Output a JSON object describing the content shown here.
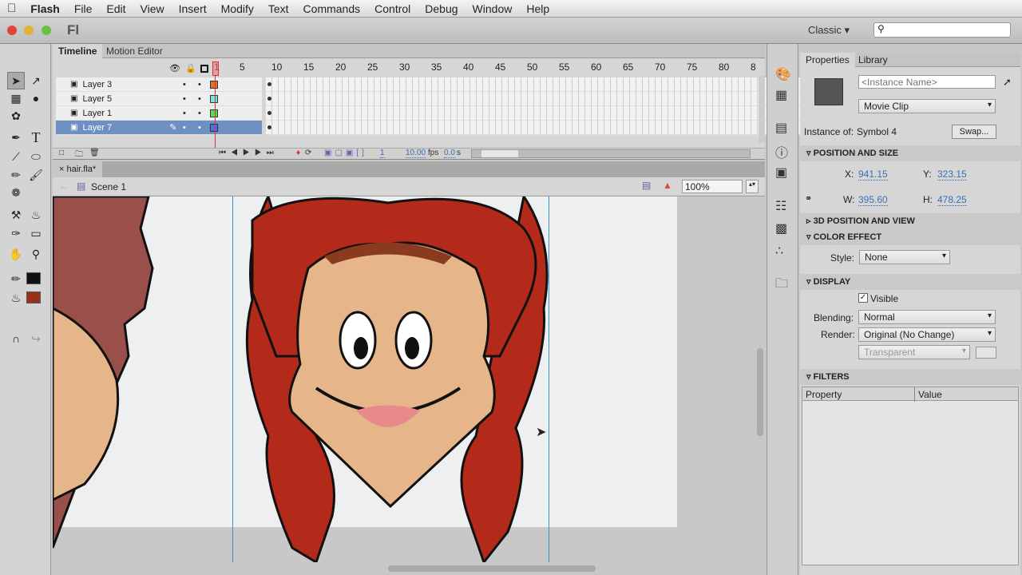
{
  "menu": {
    "apple": "",
    "items": [
      "Flash",
      "File",
      "Edit",
      "View",
      "Insert",
      "Modify",
      "Text",
      "Commands",
      "Control",
      "Debug",
      "Window",
      "Help"
    ]
  },
  "appbar": {
    "logo": "Fl",
    "workspace": "Classic",
    "search_placeholder": ""
  },
  "timeline": {
    "tabs": [
      "Timeline",
      "Motion Editor"
    ],
    "ruler": [
      "1",
      "5",
      "10",
      "15",
      "20",
      "25",
      "30",
      "35",
      "40",
      "45",
      "50",
      "55",
      "60",
      "65",
      "70",
      "75",
      "80",
      "8"
    ],
    "layers": [
      {
        "name": "Layer 3",
        "color": "#e07030"
      },
      {
        "name": "Layer 5",
        "color": "#70e8e0"
      },
      {
        "name": "Layer 1",
        "color": "#50e050"
      },
      {
        "name": "Layer 7",
        "color": "#4a70e0",
        "selected": true
      }
    ],
    "current_frame": "1",
    "fps": "10.00",
    "fps_unit": "fps",
    "time": "0.0",
    "time_unit": "s"
  },
  "document": {
    "tab": "hair.fla*",
    "scene": "Scene 1",
    "zoom": "100%"
  },
  "properties": {
    "tabs": [
      "Properties",
      "Library"
    ],
    "instance_name_placeholder": "<Instance Name>",
    "type": "Movie Clip",
    "instance_of_label": "Instance of:",
    "instance_of": "Symbol 4",
    "swap": "Swap...",
    "position_size": {
      "title": "POSITION AND SIZE",
      "x_label": "X:",
      "x": "941.15",
      "y_label": "Y:",
      "y": "323.15",
      "w_label": "W:",
      "w": "395.60",
      "h_label": "H:",
      "h": "478.25"
    },
    "three_d": {
      "title": "3D POSITION AND VIEW"
    },
    "color_effect": {
      "title": "COLOR EFFECT",
      "style_label": "Style:",
      "style": "None"
    },
    "display": {
      "title": "DISPLAY",
      "visible_label": "Visible",
      "visible": true,
      "blending_label": "Blending:",
      "blending": "Normal",
      "render_label": "Render:",
      "render": "Original (No Change)",
      "bg": "Transparent"
    },
    "filters": {
      "title": "FILTERS",
      "columns": [
        "Property",
        "Value"
      ]
    }
  },
  "colors": {
    "stroke": "#111111",
    "fill": "#9a3018",
    "selection": "#6d8fc2"
  }
}
